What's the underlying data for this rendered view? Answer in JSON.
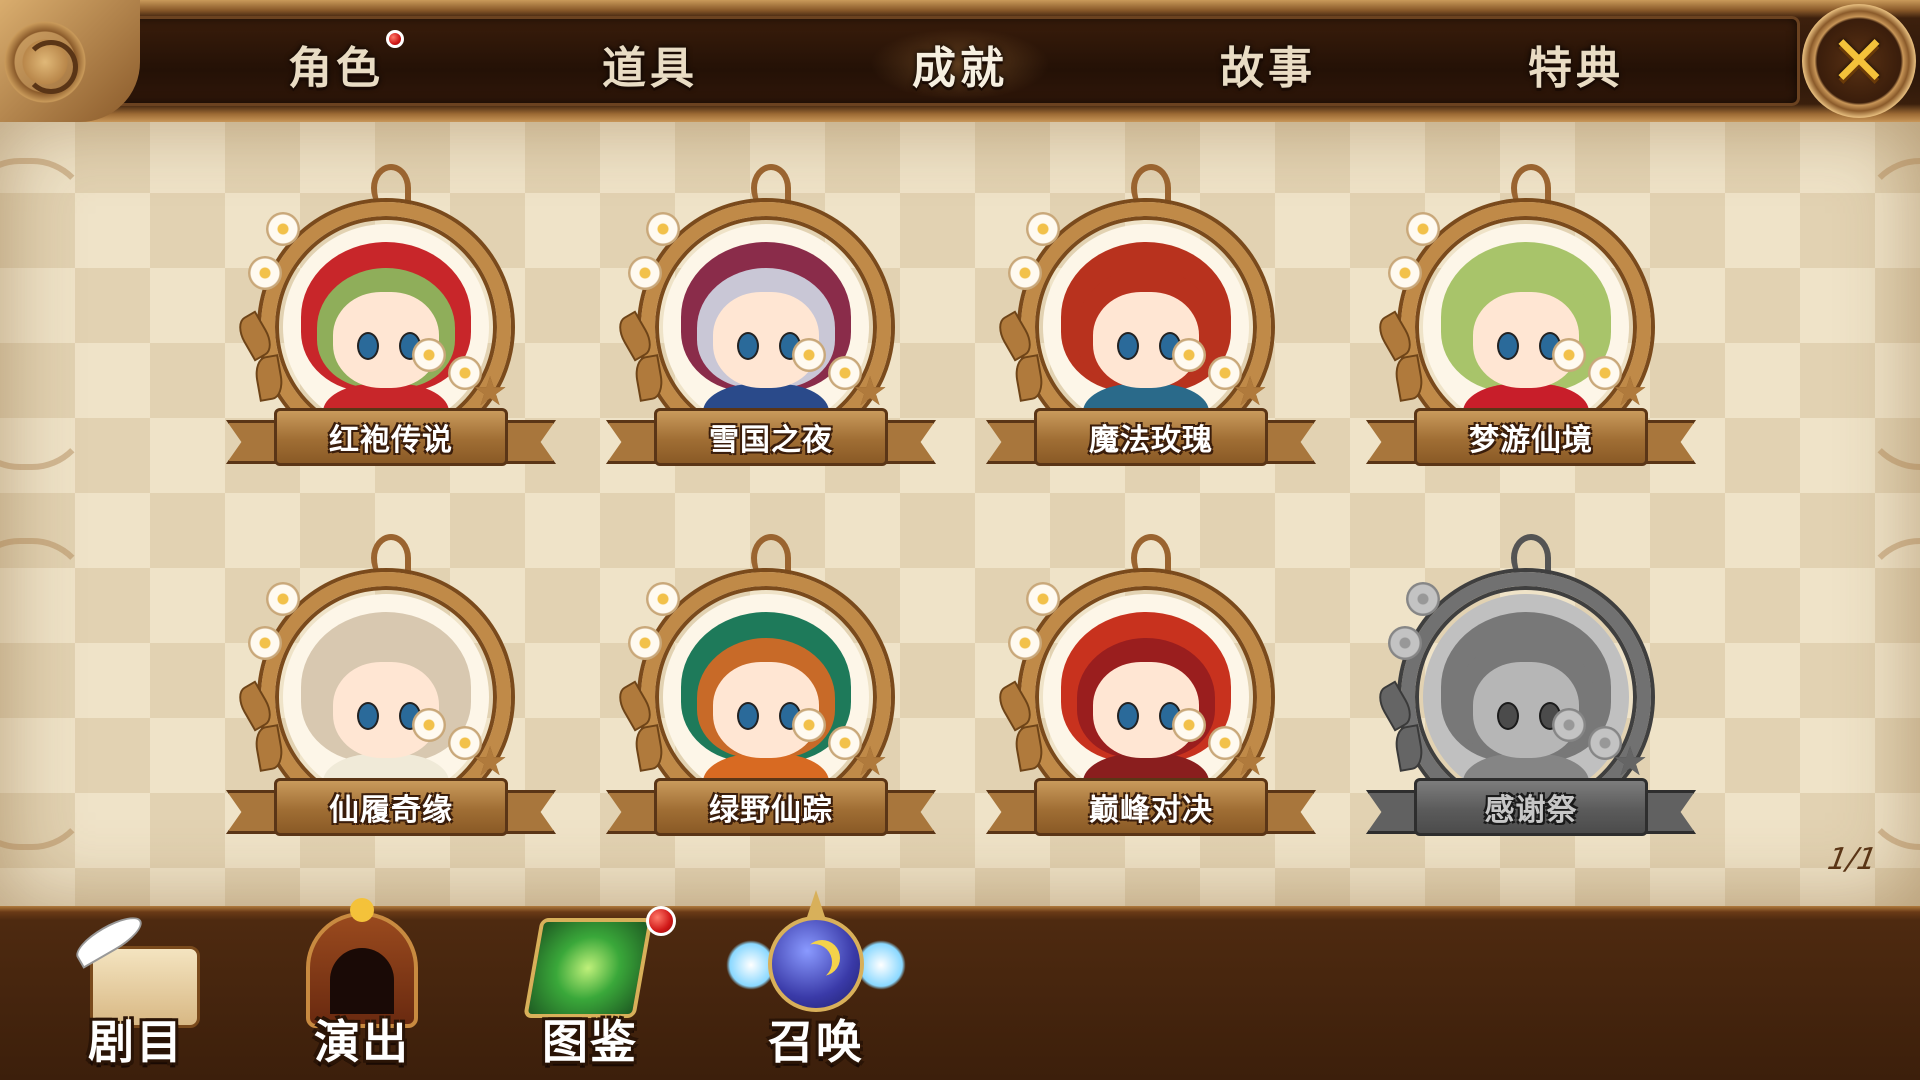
{
  "tabs": [
    {
      "label": "角色",
      "has_badge": true
    },
    {
      "label": "道具",
      "has_badge": false
    },
    {
      "label": "成就",
      "has_badge": false,
      "active": true
    },
    {
      "label": "故事",
      "has_badge": false
    },
    {
      "label": "特典",
      "has_badge": false
    }
  ],
  "close_icon": "close-x-icon",
  "medals": [
    {
      "label": "红袍传说",
      "locked": false,
      "hair": "#8fae5a",
      "hood": "#c8262a",
      "outfit": "#c8262a"
    },
    {
      "label": "雪国之夜",
      "locked": false,
      "hair": "#c9c7d6",
      "hood": "#8a2c4a",
      "outfit": "#2a4a8a"
    },
    {
      "label": "魔法玫瑰",
      "locked": false,
      "hair": "#b8321e",
      "hood": "#b8321e",
      "outfit": "#2a6a8a"
    },
    {
      "label": "梦游仙境",
      "locked": false,
      "hair": "#a8c46a",
      "hood": "#a8c46a",
      "outfit": "#c81e2a"
    },
    {
      "label": "仙履奇缘",
      "locked": false,
      "hair": "#d8c8b0",
      "hood": "#d8c8b0",
      "outfit": "#f0ead8"
    },
    {
      "label": "绿野仙踪",
      "locked": false,
      "hair": "#c86a28",
      "hood": "#1e7a5a",
      "outfit": "#d86a22"
    },
    {
      "label": "巅峰对决",
      "locked": false,
      "hair": "#9a1e1e",
      "hood": "#c8321e",
      "outfit": "#8a1e1e"
    },
    {
      "label": "感谢祭",
      "locked": true,
      "hair": "#9a9a9a",
      "hood": "#9a9a9a",
      "outfit": "#aaaaaa"
    }
  ],
  "page_indicator": "1/1",
  "bottom_nav": [
    {
      "label": "剧目",
      "icon": "scroll-quill-icon",
      "has_badge": false
    },
    {
      "label": "演出",
      "icon": "theater-stage-icon",
      "has_badge": false
    },
    {
      "label": "图鉴",
      "icon": "green-book-icon",
      "has_badge": true
    },
    {
      "label": "召唤",
      "icon": "winged-moon-orb-icon",
      "has_badge": false
    }
  ]
}
